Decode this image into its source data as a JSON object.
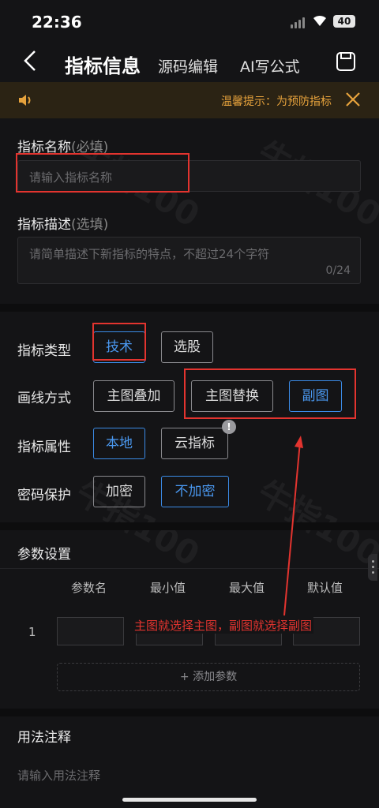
{
  "status_bar": {
    "time": "22:36",
    "battery": "40"
  },
  "nav": {
    "title": "指标信息",
    "tabs": [
      "源码编辑",
      "AI写公式"
    ]
  },
  "notice": {
    "text": "温馨提示：为预防指标"
  },
  "form": {
    "name_label": "指标名称",
    "name_hint": "(必填)",
    "name_placeholder": "请输入指标名称",
    "desc_label": "指标描述",
    "desc_hint": "(选填)",
    "desc_placeholder": "请简单描述下新指标的特点，不超过24个字符",
    "desc_counter": "0/24"
  },
  "options": {
    "type": {
      "label": "指标类型",
      "choices": [
        "技术",
        "选股"
      ],
      "selected": "技术"
    },
    "draw": {
      "label": "画线方式",
      "choices": [
        "主图叠加",
        "主图替换",
        "副图"
      ],
      "selected": "副图"
    },
    "attr": {
      "label": "指标属性",
      "choices": [
        "本地",
        "云指标"
      ],
      "selected": "本地"
    },
    "pwd": {
      "label": "密码保护",
      "choices": [
        "加密",
        "不加密"
      ],
      "selected": "不加密"
    }
  },
  "params": {
    "title": "参数设置",
    "headers": [
      "参数名",
      "最小值",
      "最大值",
      "默认值"
    ],
    "rows": [
      {
        "index": "1"
      }
    ],
    "add_label": "+ 添加参数"
  },
  "usage": {
    "title": "用法注释",
    "placeholder": "请输入用法注释"
  },
  "annotation": {
    "text": "主图就选择主图，副图就选择副图"
  },
  "watermark": "牛指100",
  "colors": {
    "accent": "#4a98f0",
    "notice": "#e6a23c",
    "highlight": "#e3342f"
  }
}
